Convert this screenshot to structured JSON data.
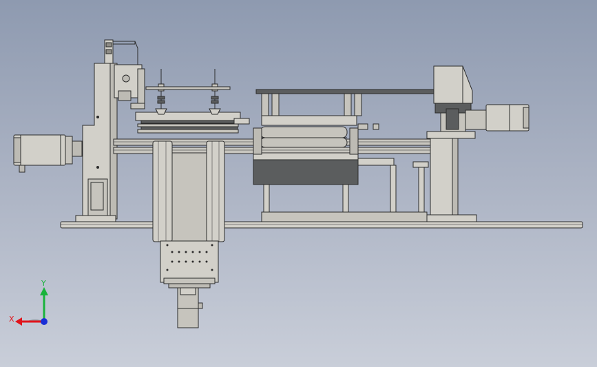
{
  "viewport": {
    "background_top": "#8e9ab0",
    "background_bottom": "#c9ced9",
    "part_fill": "#d2d0c9",
    "part_shade": "#b8b6ae",
    "edge_color": "#2b2b2b",
    "dark_part": "#5b5d5e"
  },
  "triad": {
    "x_label": "X",
    "y_label": "Y",
    "x_color": "#e0141b",
    "y_color": "#19b33b",
    "z_color": "#1a2fd6"
  }
}
